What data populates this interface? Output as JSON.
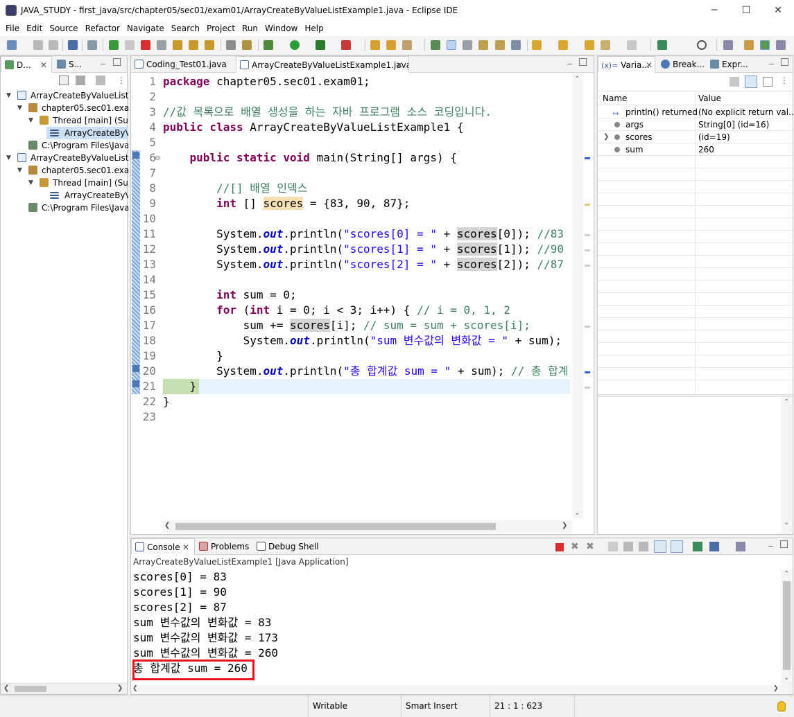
{
  "window": {
    "title": "JAVA_STUDY - first_java/src/chapter05/sec01/exam01/ArrayCreateByValueListExample1.java - Eclipse IDE",
    "minimize": "─",
    "maximize": "☐",
    "close": "✕"
  },
  "menu": [
    "File",
    "Edit",
    "Source",
    "Refactor",
    "Navigate",
    "Search",
    "Project",
    "Run",
    "Window",
    "Help"
  ],
  "left_panel": {
    "tabs": [
      "D...",
      "S..."
    ],
    "tree": [
      "ArrayCreateByValueListExa",
      "chapter05.sec01.exam",
      "Thread [main] (Susp",
      "ArrayCreateByVa",
      "C:\\Program Files\\Java",
      "ArrayCreateByValueListExa",
      "chapter05.sec01.exam",
      "Thread [main] (Susp",
      "ArrayCreateByVa",
      "C:\\Program Files\\Java"
    ]
  },
  "editor": {
    "tabs": [
      "Coding_Test01.java",
      "ArrayCreateByValueListExample1.java"
    ],
    "line_numbers": [
      "1",
      "2",
      "3",
      "4",
      "5",
      "6",
      "7",
      "8",
      "9",
      "10",
      "11",
      "12",
      "13",
      "14",
      "15",
      "16",
      "17",
      "18",
      "19",
      "20",
      "21",
      "22",
      "23"
    ],
    "fold_marker": "⊖",
    "current_line": 21
  },
  "variables_panel": {
    "tabs": [
      "Varia...",
      "Break...",
      "Expr..."
    ],
    "headers": [
      "Name",
      "Value"
    ],
    "rows": [
      {
        "name": "println() returned",
        "value": "(No explicit return val..."
      },
      {
        "name": "args",
        "value": "String[0]  (id=16)"
      },
      {
        "name": "scores",
        "value": "(id=19)"
      },
      {
        "name": "sum",
        "value": "260"
      }
    ]
  },
  "console": {
    "tabs": [
      "Console",
      "Problems",
      "Debug Shell"
    ],
    "launch": "ArrayCreateByValueListExample1 [Java Application]",
    "lines": [
      "scores[0] = 83",
      "scores[1] = 90",
      "scores[2] = 87",
      "sum 변수값의 변화값 = 83",
      "sum 변수값의 변화값 = 173",
      "sum 변수값의 변화값 = 260",
      "총 합계값 sum = 260"
    ]
  },
  "status": {
    "writable": "Writable",
    "insert_mode": "Smart Insert",
    "position": "21 : 1 : 623"
  },
  "colors": {
    "highlight_box": "#e8141e",
    "current_line": "#e8f2fe",
    "keyword": "#7f0055",
    "comment": "#3f7f5f",
    "string": "#2a00ff"
  }
}
